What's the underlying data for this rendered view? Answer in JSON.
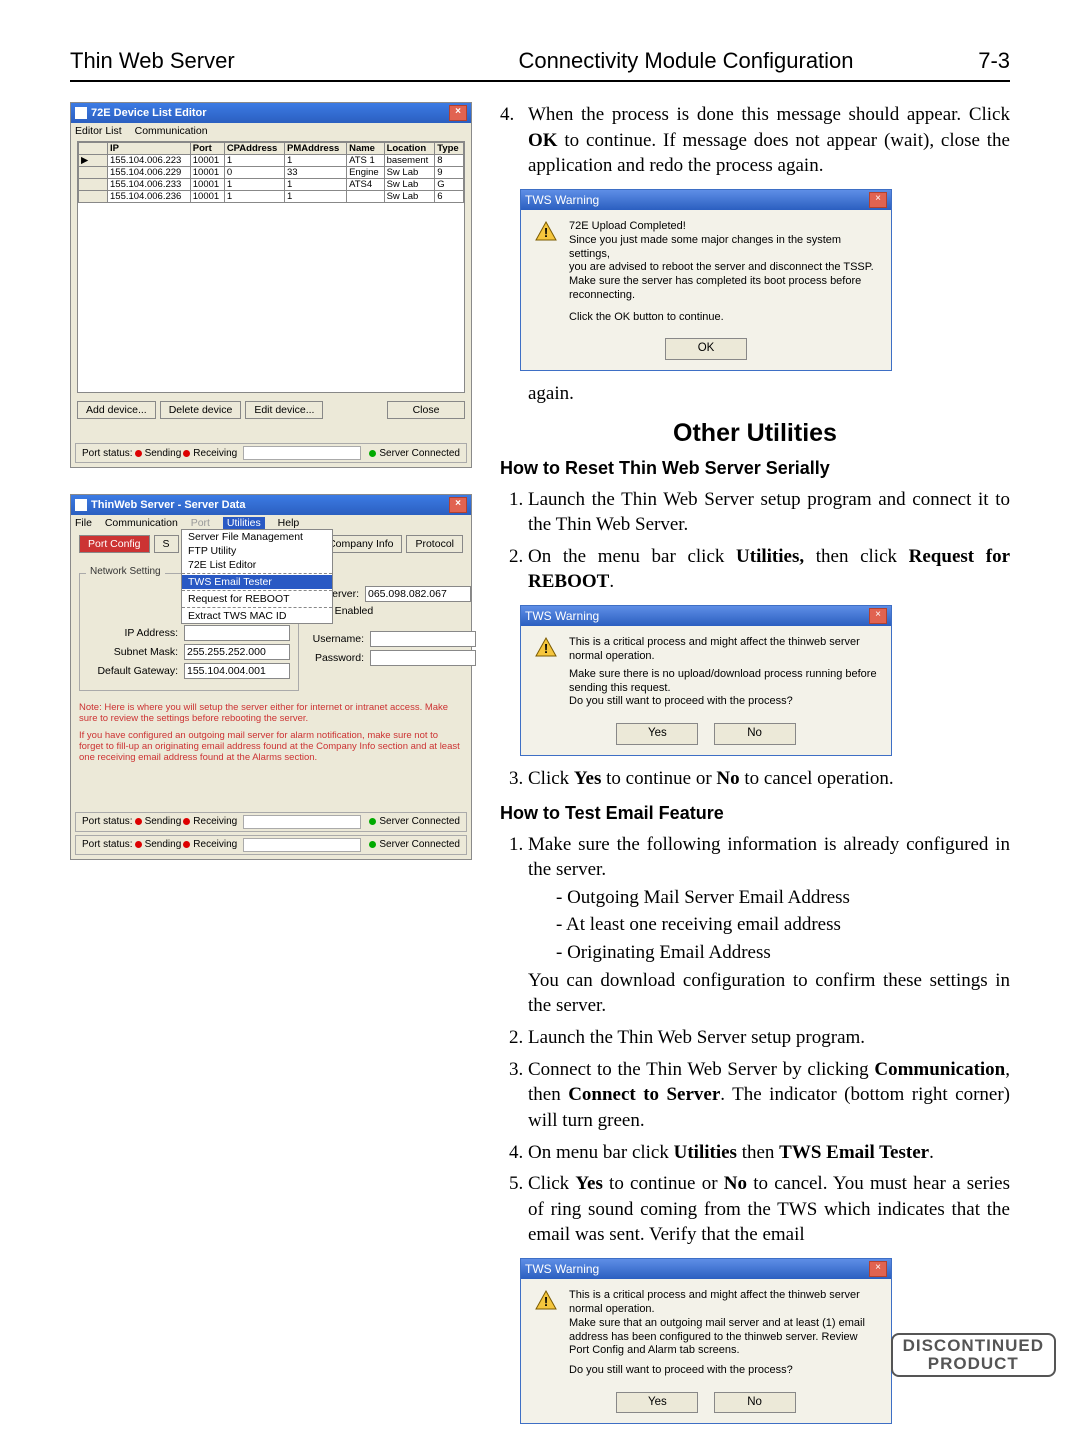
{
  "header": {
    "left": "Thin Web Server",
    "mid": "Connectivity Module Configuration",
    "right": "7-3"
  },
  "deviceEditor": {
    "title": "72E Device List Editor",
    "menu": [
      "Editor List",
      "Communication"
    ],
    "cols": [
      "IP",
      "Port",
      "CPAddress",
      "PMAddress",
      "Name",
      "Location",
      "Type"
    ],
    "rows": [
      {
        "ip": "155.104.006.223",
        "port": "10001",
        "cp": "1",
        "pm": "1",
        "name": "ATS 1",
        "loc": "basement",
        "type": "8"
      },
      {
        "ip": "155.104.006.229",
        "port": "10001",
        "cp": "0",
        "pm": "33",
        "name": "Engine",
        "loc": "Sw Lab",
        "type": "9"
      },
      {
        "ip": "155.104.006.233",
        "port": "10001",
        "cp": "1",
        "pm": "1",
        "name": "ATS4",
        "loc": "Sw Lab",
        "type": "G"
      },
      {
        "ip": "155.104.006.236",
        "port": "10001",
        "cp": "1",
        "pm": "1",
        "name": "",
        "loc": "Sw Lab",
        "type": "6"
      }
    ],
    "buttons": {
      "add": "Add device...",
      "del": "Delete device",
      "edit": "Edit device...",
      "close": "Close"
    },
    "status": {
      "label": "Port status:",
      "send": "Sending",
      "recv": "Receiving",
      "conn": "Server Connected"
    }
  },
  "serverData": {
    "title": "ThinWeb Server - Server Data",
    "menu": [
      "File",
      "Communication",
      "Port",
      "Utilities",
      "Help"
    ],
    "menuActiveIndex": 3,
    "dropdown": [
      "Server File Management",
      "FTP Utility",
      "72E List Editor",
      "TWS Email Tester",
      "Request for REBOOT",
      "Extract TWS MAC ID"
    ],
    "dropdownHighlight": 3,
    "tabs": {
      "port": "Port Config",
      "s": "S",
      "comp": "Company Info",
      "proto": "Protocol"
    },
    "fieldset": "Network Setting",
    "fields": {
      "ipLabel": "IP Address:",
      "ip": "",
      "snLabel": "Subnet Mask:",
      "sn": "255.255.252.000",
      "gwLabel": "Default Gateway:",
      "gw": "155.104.004.001",
      "unLabel": "Username:",
      "un": "",
      "pwLabel": "Password:",
      "pw": "",
      "srvLabel": "il Server:",
      "srv": "065.098.082.067",
      "ationLabel": "ation Enabled"
    },
    "note1": "Note: Here is where you will setup the server either for internet or intranet access. Make sure to review the settings before rebooting the server.",
    "note2": "If you have configured an outgoing mail server for alarm notification, make sure not to forget to fill-up an originating email address found at the Company Info section and at least one receiving email address found at the Alarms section.",
    "status": {
      "label": "Port status:",
      "send": "Sending",
      "recv": "Receiving",
      "conn": "Server Connected"
    },
    "status2": {
      "label": "Port status:",
      "send": "Sending",
      "recv": "Receiving",
      "conn": "Server Connected"
    }
  },
  "right": {
    "step4_lead": "4.",
    "step4": "When the process is done this message should appear. Click ",
    "ok": "OK",
    "step4b": " to continue. If message does not appear (wait), close the application and redo the process again.",
    "again": "again.",
    "dlg1": {
      "title": "TWS Warning",
      "l1": "72E Upload Completed!",
      "l2": "Since you just made some major changes in the system settings,",
      "l3": "you are advised to reboot the server and disconnect the TSSP.",
      "l4": "Make sure the server has completed its boot process before reconnecting.",
      "l5": "Click the OK button to continue.",
      "ok": "OK"
    },
    "otherUtil": "Other Utilities",
    "howReset": "How to Reset Thin Web Server Serially",
    "reset1": "Launch the Thin Web Server setup program and connect it to the Thin Web Server.",
    "reset2a": "On the menu bar click ",
    "utilities": "Utilities,",
    "reset2b": " then click ",
    "reqReboot": "Request for REBOOT",
    "period": ".",
    "dlg2": {
      "title": "TWS Warning",
      "l1": "This is a critical process and might affect the thinweb server normal operation.",
      "l2": "Make sure there is no upload/download process running before sending this request.",
      "l3": "Do you still want to proceed with the process?",
      "yes": "Yes",
      "no": "No"
    },
    "reset3a": "Click ",
    "yes": "Yes",
    "reset3b": " to continue or ",
    "no": "No",
    "reset3c": " to cancel operation.",
    "howEmail": "How to Test Email Feature",
    "email1": "Make sure the following information is already configured in the server.",
    "emailSub1": "- Outgoing Mail Server Email Address",
    "emailSub2": "- At least one receiving email address",
    "emailSub3": "- Originating Email Address",
    "email1b": "You can download configuration to confirm these settings in the server.",
    "email2": "Launch the Thin Web Server setup program.",
    "email3a": "Connect to the Thin Web Server by clicking ",
    "comm": "Communication",
    "email3b": ", then ",
    "connSrv": "Connect to Server",
    "email3c": ". The indicator (bottom right corner) will turn green.",
    "email4a": "On menu bar click ",
    "util2": "Utilities",
    "email4b": " then ",
    "twsTester": "TWS Email Tester",
    "email5": "Click ",
    "email5b": " to continue or ",
    "email5c": " to cancel. You must hear a series of ring sound coming from the TWS which indicates that the email was sent. Verify that the email",
    "dlg3": {
      "title": "TWS Warning",
      "l1": "This is a critical process and might affect the thinweb server normal operation.",
      "l2": "Make sure that an outgoing mail server and at least (1) email address has been configured to the thinweb server. Review Port Config and Alarm tab screens.",
      "l3": "Do you still want to proceed with the process?",
      "yes": "Yes",
      "no": "No"
    }
  },
  "stamp": {
    "l1": "DISCONTINUED",
    "l2": "PRODUCT"
  }
}
